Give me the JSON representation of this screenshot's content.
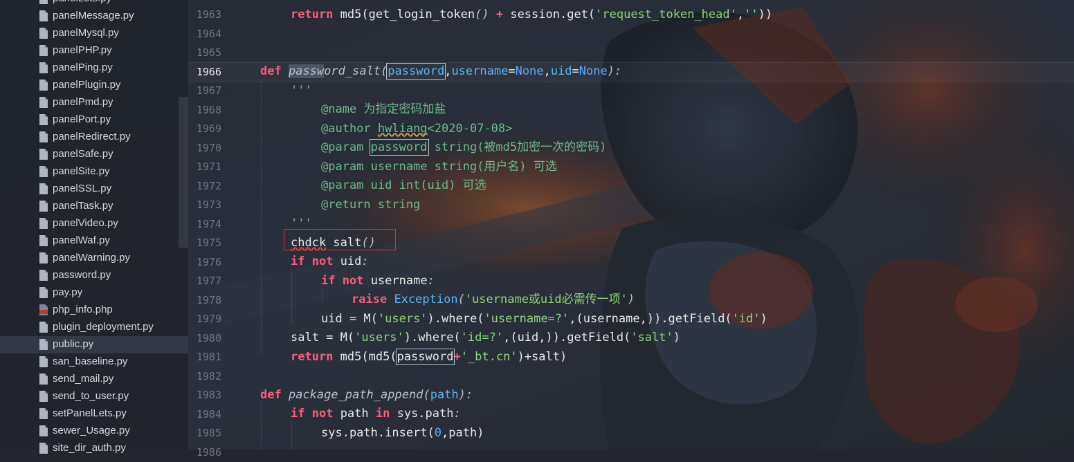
{
  "sidebar": {
    "files": [
      {
        "name": "panelLets.py",
        "type": "py"
      },
      {
        "name": "panelMessage.py",
        "type": "py"
      },
      {
        "name": "panelMysql.py",
        "type": "py"
      },
      {
        "name": "panelPHP.py",
        "type": "py"
      },
      {
        "name": "panelPing.py",
        "type": "py"
      },
      {
        "name": "panelPlugin.py",
        "type": "py"
      },
      {
        "name": "panelPmd.py",
        "type": "py"
      },
      {
        "name": "panelPort.py",
        "type": "py"
      },
      {
        "name": "panelRedirect.py",
        "type": "py"
      },
      {
        "name": "panelSafe.py",
        "type": "py"
      },
      {
        "name": "panelSite.py",
        "type": "py"
      },
      {
        "name": "panelSSL.py",
        "type": "py"
      },
      {
        "name": "panelTask.py",
        "type": "py"
      },
      {
        "name": "panelVideo.py",
        "type": "py"
      },
      {
        "name": "panelWaf.py",
        "type": "py"
      },
      {
        "name": "panelWarning.py",
        "type": "py"
      },
      {
        "name": "password.py",
        "type": "py"
      },
      {
        "name": "pay.py",
        "type": "py"
      },
      {
        "name": "php_info.php",
        "type": "php"
      },
      {
        "name": "plugin_deployment.py",
        "type": "py"
      },
      {
        "name": "public.py",
        "type": "py",
        "active": true
      },
      {
        "name": "san_baseline.py",
        "type": "py"
      },
      {
        "name": "send_mail.py",
        "type": "py"
      },
      {
        "name": "send_to_user.py",
        "type": "py"
      },
      {
        "name": "setPanelLets.py",
        "type": "py"
      },
      {
        "name": "sewer_Usage.py",
        "type": "py"
      },
      {
        "name": "site_dir_auth.py",
        "type": "py"
      }
    ]
  },
  "editor": {
    "current_line": "1966",
    "line_numbers": [
      "1963",
      "1964",
      "1965",
      "1966",
      "1967",
      "1968",
      "1969",
      "1970",
      "1971",
      "1972",
      "1973",
      "1974",
      "1975",
      "1976",
      "1977",
      "1978",
      "1979",
      "1980",
      "1981",
      "1982",
      "1983",
      "1984",
      "1985",
      "1986"
    ],
    "code": {
      "l1963": {
        "ret": "return",
        "a": " md5(get_login_token",
        "par": "()",
        "plus": " + ",
        "b": "session.get(",
        "s1": "'request_token_head'",
        ",": ",",
        "s2": "''",
        "end": "))"
      },
      "l1966": {
        "def": "def",
        "sel": "passw",
        "fname": "ord_salt",
        "open": "(",
        "p1": "password",
        ",1": ",",
        "p2": "username",
        "eq1": "=",
        "none1": "None",
        ",2": ",",
        "p3": "uid",
        "eq2": "=",
        "none2": "None",
        "close": "):"
      },
      "l1967": "'''",
      "l1968": "@name 为指定密码加盐",
      "l1969a": "@author ",
      "l1969b": "hwliang",
      "l1969c": "<2020-07-08>",
      "l1970a": "@param ",
      "l1970b": "password",
      "l1970c": " string(被md5加密一次的密码)",
      "l1971": "@param username string(用户名) 可选",
      "l1972": "@param uid int(uid) 可选",
      "l1973": "@return string",
      "l1974": "'''",
      "l1975a": "chdck",
      "l1975b": " salt",
      "l1975c": "()",
      "l1976": {
        "if": "if",
        "not": "not",
        "rest": " uid",
        ":": ":"
      },
      "l1977": {
        "if": "if",
        "not": "not",
        "rest": " username",
        ":": ":"
      },
      "l1978": {
        "raise": "raise",
        "exc": "Exception",
        "o": "(",
        "s": "'username或uid必需传一项'",
        "c": ")"
      },
      "l1979": {
        "a": "uid = M(",
        "s1": "'users'",
        "b": ").where(",
        "s2": "'username=?'",
        "c": ",(username,)).getField(",
        "s3": "'id'",
        "d": ")"
      },
      "l1980": {
        "a": "salt = M(",
        "s1": "'users'",
        "b": ").where(",
        "s2": "'id=?'",
        "c": ",(uid,)).getField(",
        "s3": "'salt'",
        "d": ")"
      },
      "l1981": {
        "ret": "return",
        "a": " md5(md5(",
        "pw": "password",
        "plus": "+",
        "s": "'_bt.cn'",
        "b": ")+salt)"
      },
      "l1983": {
        "def": "def",
        "fname": "package_path_append",
        "o": "(",
        "p": "path",
        "c": "):"
      },
      "l1984": {
        "if": "if",
        "not": "not",
        "a": " path ",
        "in": "in",
        "b": " sys.path",
        ":": ":"
      },
      "l1985": {
        "a": "sys.path.insert(",
        "n": "0",
        "b": ",path)"
      }
    }
  },
  "colors": {
    "keyword": "#ff5a7a",
    "comment": "#6fb98a",
    "string": "#8fd47a",
    "function_name": "#b8c0cc",
    "parameter": "#59b6f0",
    "constant": "#5fa8ff",
    "annotation_box": "#e03030"
  }
}
